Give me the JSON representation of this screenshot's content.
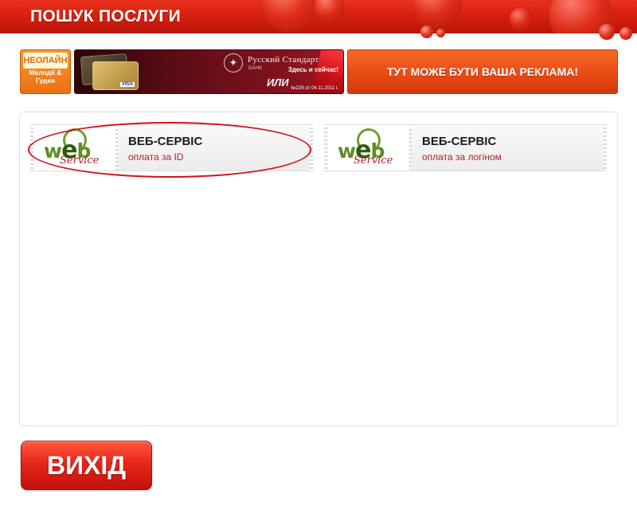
{
  "header": {
    "title": "ПОШУК ПОСЛУГИ"
  },
  "banners": {
    "neoline": {
      "logo_text": "НЕОЛАЙН",
      "caption": "Мелодії & Гудки"
    },
    "rsb": {
      "bank_name": "Русский Стандарт",
      "bank_sub": "БАНК",
      "or_text": "ИЛИ",
      "promo": "Здесь и сейчас!",
      "fine_print": "№226 от 04.11.2011 г."
    },
    "ad_placeholder": "ТУТ МОЖЕ БУТИ ВАША РЕКЛАМА!"
  },
  "services": [
    {
      "title": "ВЕБ-СЕРВІС",
      "subtitle": "оплата за ID",
      "logo_word": "web",
      "logo_script": "Service",
      "highlighted": true
    },
    {
      "title": "ВЕБ-СЕРВІС",
      "subtitle": "оплата за логіном",
      "logo_word": "web",
      "logo_script": "Service",
      "highlighted": false
    }
  ],
  "footer": {
    "exit_label": "ВИХІД"
  },
  "colors": {
    "header_red": "#d31e0e",
    "accent_orange": "#ea4a14",
    "logo_green": "#5f8d23",
    "subtitle_red": "#b02121",
    "highlight_red": "#d1101a"
  }
}
